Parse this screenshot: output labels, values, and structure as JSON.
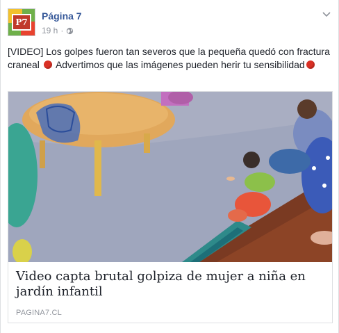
{
  "post": {
    "page_name": "Página 7",
    "avatar_text": "P7",
    "time": "19 h",
    "separator": "·",
    "privacy_icon": "globe-icon",
    "menu_icon": "chevron-down-icon",
    "text_part1": "[VIDEO] Los golpes fueron tan severos que la pequeña quedó con fractura craneal",
    "text_part2": "Advertimos que las imágenes pueden herir tu sensibilidad",
    "emoji_name": "red-circle-emoji",
    "emoji_color": "#d93025"
  },
  "link": {
    "title": "Video capta brutal golpiza de mujer a niña en jardín infantil",
    "domain": "PAGINA7.CL"
  },
  "colors": {
    "page_name": "#365899",
    "meta": "#90949c",
    "text": "#1d2129",
    "border": "#dddfe2",
    "background": "#e9ebee"
  }
}
